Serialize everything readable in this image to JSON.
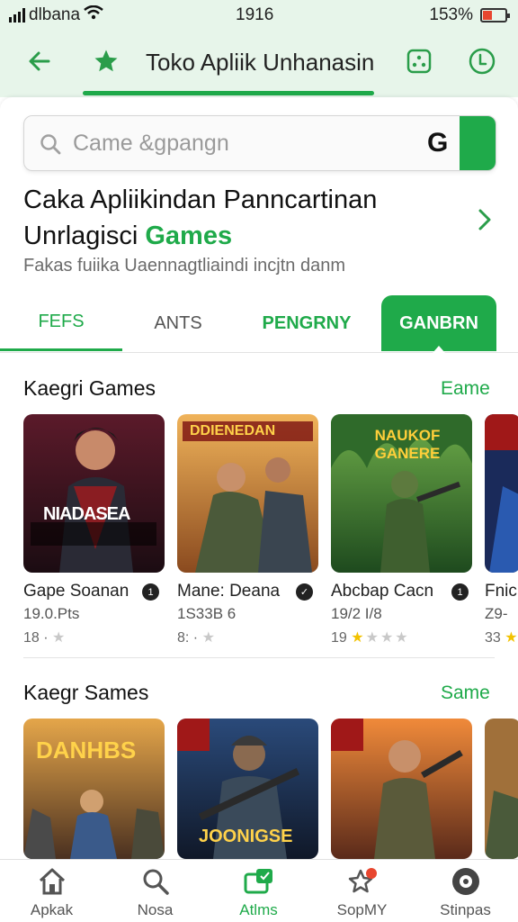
{
  "status_bar": {
    "carrier": "dlbana",
    "time": "1916",
    "battery": "153%"
  },
  "header": {
    "title": "Toko Apliik Unhanasin",
    "icons": [
      "back-arrow-icon",
      "star-icon",
      "dice-icon",
      "download-icon"
    ]
  },
  "search": {
    "placeholder": "Came &gpangn",
    "g_label": "G"
  },
  "headline": {
    "line1": "Caka Apliikindan Panncartinan",
    "line2_prefix": "Unrlagisci ",
    "line2_accent": "Games",
    "subtitle": "Fakas fuiika Uaennagtliaindi incjtn danm"
  },
  "tabs": [
    {
      "label": "FEFS",
      "state": "selected-underline"
    },
    {
      "label": "ANTS",
      "state": "normal"
    },
    {
      "label": "PENGRNY",
      "state": "accent"
    },
    {
      "label": "GANBRN",
      "state": "filled"
    }
  ],
  "sections": [
    {
      "title": "Kaegri Games",
      "link": "Eame",
      "items": [
        {
          "name": "Gape Soanan",
          "meta": "19.0.Pts",
          "rating": "18",
          "stars_on": 0,
          "stars_off": 1,
          "art_text": "NIADASEA"
        },
        {
          "name": "Mane: Deana",
          "meta": "1S33B 6",
          "rating": "8:",
          "stars_on": 0,
          "stars_off": 1,
          "art_text": "DDIENEDAN"
        },
        {
          "name": "Abcbap Cacn",
          "meta": "19/2 I/8",
          "rating": "19",
          "stars_on": 1,
          "stars_off": 3,
          "art_text": "NAUKOF GANERE"
        },
        {
          "name": "Fnic",
          "meta": "Z9-",
          "rating": "33",
          "stars_on": 1,
          "stars_off": 0,
          "art_text": ""
        }
      ]
    },
    {
      "title": "Kaegr Sames",
      "link": "Same",
      "items": [
        {
          "art_text": "DANHBS"
        },
        {
          "art_text": "JOONIGSE"
        },
        {
          "art_text": ""
        },
        {
          "art_text": ""
        }
      ]
    }
  ],
  "bottom_nav": [
    {
      "label": "Apkak",
      "icon": "home-icon"
    },
    {
      "label": "Nosa",
      "icon": "search-icon"
    },
    {
      "label": "Atlms",
      "icon": "apps-icon",
      "active": true
    },
    {
      "label": "SopMY",
      "icon": "star-badge-icon"
    },
    {
      "label": "Stinpas",
      "icon": "settings-circle-icon"
    }
  ],
  "colors": {
    "accent": "#1faa4a",
    "header_bg": "#e7f5ea"
  }
}
